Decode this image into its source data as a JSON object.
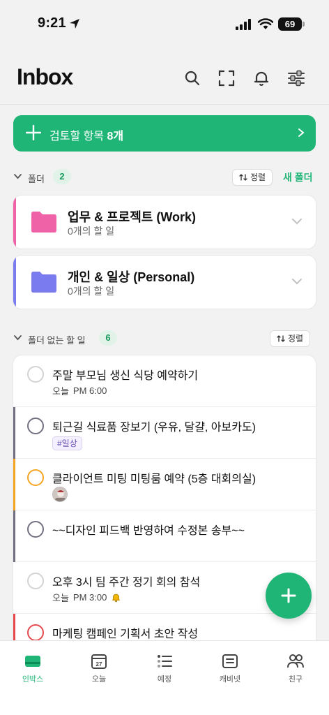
{
  "status_bar": {
    "time": "9:21",
    "battery": "69"
  },
  "header": {
    "title": "Inbox"
  },
  "review_banner": {
    "label": "검토할 항목",
    "count": "8개"
  },
  "folders_section": {
    "label": "폴더",
    "count": "2",
    "sort_label": "정렬",
    "new_folder_label": "새 폴더"
  },
  "folders": [
    {
      "name": "업무 & 프로젝트 (Work)",
      "subtitle": "0개의 할 일",
      "color": "#f062a8"
    },
    {
      "name": "개인 & 일상 (Personal)",
      "subtitle": "0개의 할 일",
      "color": "#7b7bf0"
    }
  ],
  "tasks_section": {
    "label": "폴더 없는 할 일",
    "count": "6",
    "sort_label": "정렬"
  },
  "tasks": [
    {
      "title": "주말 부모님 생신 식당 예약하기",
      "date": "오늘",
      "time": "PM 6:00"
    },
    {
      "title": "퇴근길 식료품 장보기 (우유, 달걀, 아보카도)",
      "tag": "#일상",
      "accent": "#707080"
    },
    {
      "title": "클라이언트 미팅 미팅룸 예약 (5층 대회의실)",
      "accent": "#f5a524"
    },
    {
      "title": "~~디자인 피드백 반영하여 수정본 송부~~",
      "accent": "#707080"
    },
    {
      "title": "오후 3시 팀 주간 정기 회의 참석",
      "date": "오늘",
      "time": "PM 3:00"
    },
    {
      "title": "마케팅 캠페인 기획서 초안 작성",
      "accent": "#e5484d"
    }
  ],
  "tabs": [
    {
      "label": "인박스",
      "icon": "inbox-icon"
    },
    {
      "label": "오늘",
      "icon": "calendar-today-icon",
      "day": "27"
    },
    {
      "label": "예정",
      "icon": "upcoming-list-icon"
    },
    {
      "label": "캐비넷",
      "icon": "cabinet-icon"
    },
    {
      "label": "친구",
      "icon": "friends-icon"
    }
  ],
  "colors": {
    "accent": "#1fb576"
  }
}
